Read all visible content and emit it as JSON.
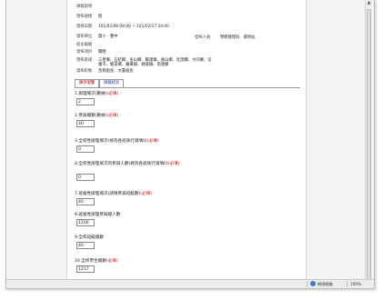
{
  "event_info": [
    {
      "key": "填報說明",
      "value": ""
    },
    {
      "key": "發佈規模",
      "value": "無"
    },
    {
      "key": "發佈日期",
      "value": "101/02/08 08:00 ~ 101/02/17 24:00"
    },
    {
      "key": "發佈單位",
      "value": "賀小 - 豐中"
    },
    {
      "key": "宿舍編號",
      "value": ""
    },
    {
      "key": "發佈項目",
      "value": "關閉"
    },
    {
      "key": "發佈區域",
      "value": "三星鄉、五結鄉、冬山鄉、蘇澳鎮、員山鄉、壯圍鄉、大同鄉、宜蘭市、礁溪鄉、羅東鎮、頭城鎮、南澳鄉"
    },
    {
      "key": "發佈對象",
      "value": "急救組長、文書組長"
    }
  ],
  "right_info": {
    "key": "發佈人員",
    "value": "學務管理科　蔡明弘"
  },
  "tabs": [
    {
      "label": "題目瀏覽"
    },
    {
      "label": "填報狀況"
    }
  ],
  "required_text": "(必填)",
  "questions": [
    {
      "label": "1.辦理場次(數據)",
      "value": "2"
    },
    {
      "label": "2.參與總數(數據)",
      "value": "40"
    },
    {
      "label": "3.全校性辦理場次(視為各班執行請填0)",
      "value": "0"
    },
    {
      "label": "4.全校性辦理場次的參與人數(視為各班執行請填0)",
      "value": "0"
    },
    {
      "label": "7.班級性辦理場次(請填參與班級數)",
      "value": "40"
    },
    {
      "label": "8.班級性辦理參與總人數",
      "value": "1200"
    },
    {
      "label": "9.全校班級總數",
      "value": "40"
    },
    {
      "label": "10.全校學生總數",
      "value": "1217"
    }
  ],
  "statusbar": {
    "zone_label": "網際網路",
    "zoom_label": "100%"
  },
  "colors": {
    "required": "#cc0000",
    "tab_link": "#1a3aa0",
    "tab_active": "#b00000"
  }
}
